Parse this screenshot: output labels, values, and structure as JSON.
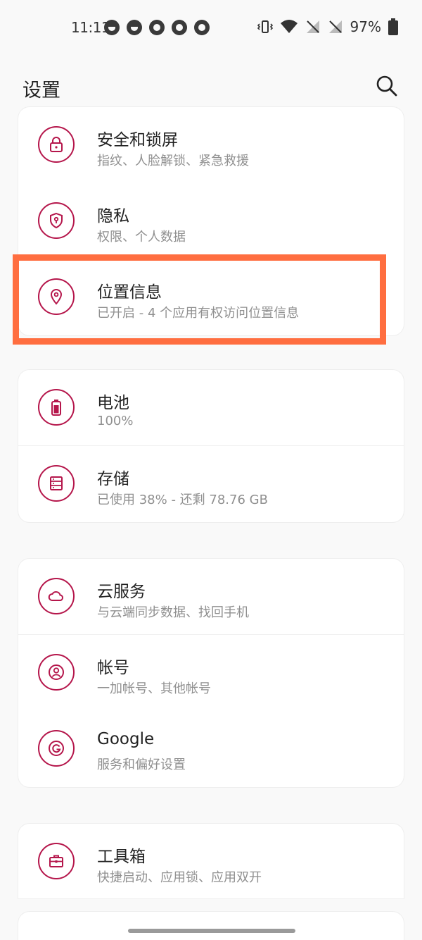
{
  "status_bar": {
    "time": "11:11",
    "battery": "97%",
    "notification_icons": [
      "moon-icon",
      "moon-icon",
      "q-app-icon",
      "q-app-icon",
      "q-app-icon"
    ]
  },
  "header": {
    "title": "设置",
    "search_icon": "search-icon"
  },
  "colors": {
    "accent": "#b5164b",
    "highlight": "#ff6e40",
    "background": "#f9f9f9",
    "card": "#ffffff"
  },
  "groups": [
    {
      "items": [
        {
          "title": "安全和锁屏",
          "subtitle": "指纹、人脸解锁、紧急救援",
          "icon": "lock-icon"
        },
        {
          "title": "隐私",
          "subtitle": "权限、个人数据",
          "icon": "privacy-shield-icon"
        },
        {
          "title": "位置信息",
          "subtitle": "已开启 - 4 个应用有权访问位置信息",
          "icon": "location-pin-icon"
        }
      ]
    },
    {
      "items": [
        {
          "title": "电池",
          "subtitle": "100%",
          "icon": "battery-icon"
        },
        {
          "title": "存储",
          "subtitle": "已使用 38% - 还剩 78.76 GB",
          "icon": "storage-icon"
        }
      ]
    },
    {
      "items": [
        {
          "title": "云服务",
          "subtitle": "与云端同步数据、找回手机",
          "icon": "cloud-icon"
        },
        {
          "title": "帐号",
          "subtitle": "一加帐号、其他帐号",
          "icon": "account-icon"
        },
        {
          "title": "Google",
          "subtitle": "服务和偏好设置",
          "icon": "google-icon"
        }
      ]
    },
    {
      "items": [
        {
          "title": "工具箱",
          "subtitle": "快捷启动、应用锁、应用双开",
          "icon": "toolbox-icon"
        }
      ]
    }
  ]
}
